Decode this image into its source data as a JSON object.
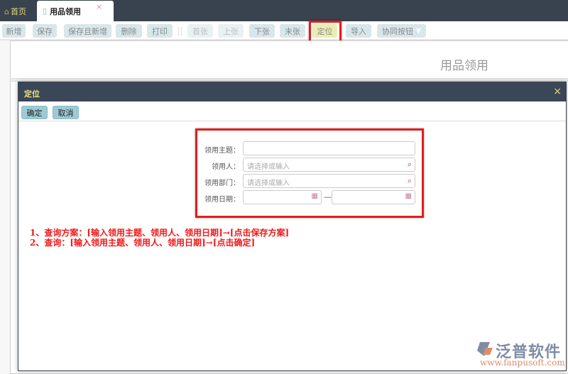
{
  "tabs": {
    "home": "首页",
    "active": "用品领用",
    "close": "×"
  },
  "toolbar": [
    "新增",
    "保存",
    "保存且新增",
    "删除",
    "打印",
    "首张",
    "上张",
    "下张",
    "末张",
    "定位",
    "导入",
    "协同按钮"
  ],
  "page_title": "用品领用",
  "modal": {
    "title": "定位",
    "close": "×",
    "confirm": "确定",
    "cancel": "取消"
  },
  "form": {
    "subject_label": "领用主题：",
    "subject_value": "",
    "user_label": "领用人：",
    "user_placeholder": "请选择或输入",
    "dept_label": "领用部门：",
    "dept_placeholder": "请选择或输入",
    "date_label": "领用日期：",
    "date_sep": "—"
  },
  "notes": [
    "1、查询方案：[输入领用主题、领用人、领用日期]→[点击保存方案]",
    "2、查询：[输入领用主题、领用人、领用日期]→[点击确定]"
  ],
  "logo": {
    "name": "泛普软件",
    "url": "www.fanpusoft.com"
  },
  "colors": {
    "accent_red": "#e51c1c",
    "header_dark": "#3b4656"
  }
}
